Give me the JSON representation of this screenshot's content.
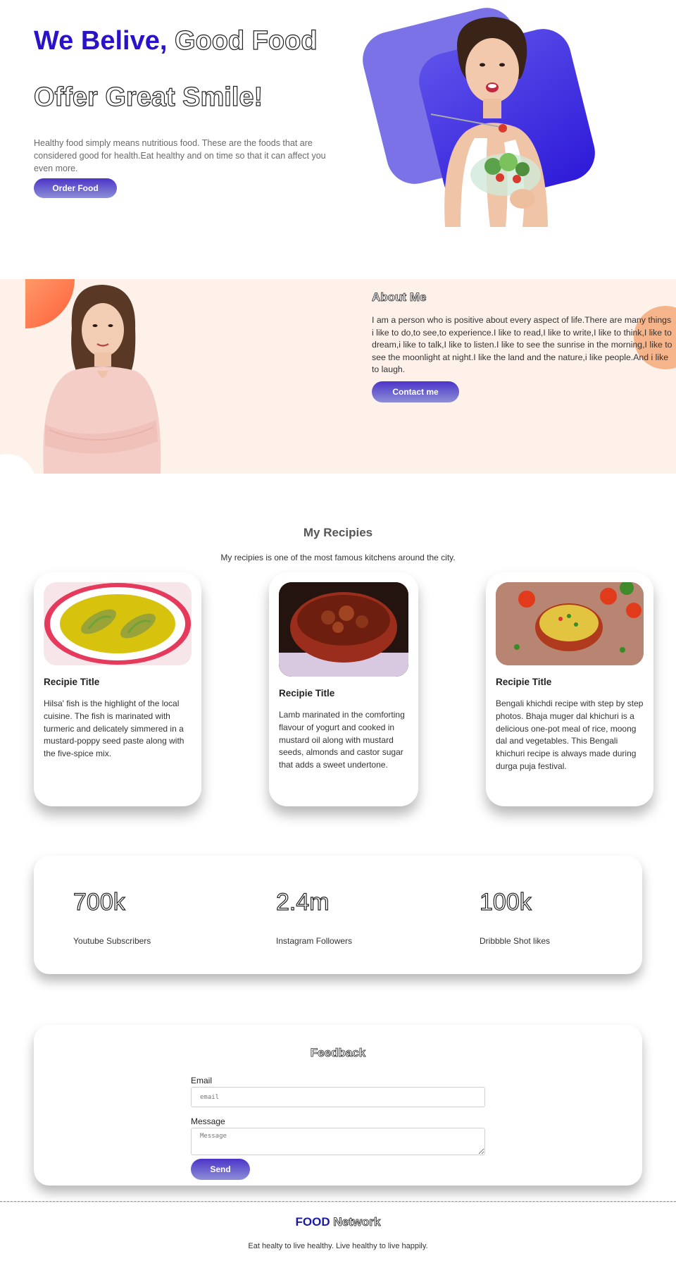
{
  "hero": {
    "title_accent": "We Belive,",
    "title_rest": " Good Food",
    "subtitle": "Offer Great Smile!",
    "text": "Healthy food simply means nutritious food. These are the foods that are considered good for health.Eat healthy and on time so that it can affect you even more.",
    "button": "Order Food"
  },
  "about": {
    "title": "About Me",
    "text": "I am a person who is positive about every aspect of life.There are many things i like to do,to see,to experience.I like to read,I like to write,I like to think,I like to dream,i like to talk,I like to listen.I like to see the sunrise in the morning,I like to see the moonlight at night.I like the land and the nature,i like people.And i like to laugh.",
    "button": "Contact me"
  },
  "recipes": {
    "title": "My Recipies",
    "subtitle": "My recipies is one of the most famous kitchens around the city.",
    "cards": [
      {
        "title": "Recipie Title",
        "text": "Hilsa' fish is the highlight of the local cuisine. The fish is marinated with turmeric and delicately simmered in a mustard-poppy seed paste along with the five-spice mix."
      },
      {
        "title": "Recipie Title",
        "text": "Lamb marinated in the comforting flavour of yogurt and cooked in mustard oil along with mustard seeds, almonds and castor sugar that adds a sweet undertone."
      },
      {
        "title": "Recipie Title",
        "text": "Bengali khichdi recipe with step by step photos. Bhaja muger dal khichuri is a delicious one-pot meal of rice, moong dal and vegetables. This Bengali khichuri recipe is always made during durga puja festival."
      }
    ]
  },
  "stats": [
    {
      "value": "700k",
      "label": "Youtube Subscribers"
    },
    {
      "value": "2.4m",
      "label": "Instagram Followers"
    },
    {
      "value": "100k",
      "label": "Dribbble Shot likes"
    }
  ],
  "feedback": {
    "title": "Feedback",
    "email_label": "Email",
    "email_placeholder": "email",
    "message_label": "Message",
    "message_placeholder": "Message",
    "button": "Send"
  },
  "footer": {
    "brand_1": "FOOD",
    "brand_2": " Network",
    "tagline": "Eat healty to live healthy. Live healthy to live happily."
  }
}
